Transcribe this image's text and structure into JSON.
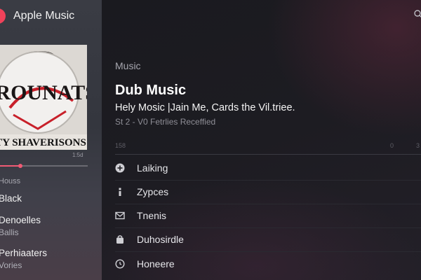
{
  "app": {
    "title": "Apple Music"
  },
  "sidebar": {
    "track_time": "1:5d",
    "progress": 0.23,
    "section_label": "Houss",
    "items": [
      {
        "title": "Black",
        "subtitle": ""
      },
      {
        "title": "Denoelles",
        "subtitle": "Ballis"
      },
      {
        "title": "Perhiaaters",
        "subtitle": "Vories"
      }
    ]
  },
  "album": {
    "art_text_top": "KROUNATS",
    "art_text_bottom": "TY SHAVERISONS"
  },
  "main": {
    "breadcrumb": "Music",
    "title": "Dub Music",
    "subtitle": "Hely Mosic |Jain Me, Cards the Vil.triee.",
    "meta": "St 2 - V0 Fetrlies Receffied",
    "col_left": "158",
    "col_mid": "0",
    "col_right": "3",
    "rows": [
      {
        "label": "Laiking",
        "icon": "plus-circle-icon"
      },
      {
        "label": "Zypces",
        "icon": "info-icon"
      },
      {
        "label": "Tnenis",
        "icon": "envelope-icon"
      },
      {
        "label": "Duhosirdle",
        "icon": "bag-icon"
      },
      {
        "label": "Honeere",
        "icon": "clock-icon"
      }
    ]
  },
  "colors": {
    "accent": "#f0425a"
  }
}
